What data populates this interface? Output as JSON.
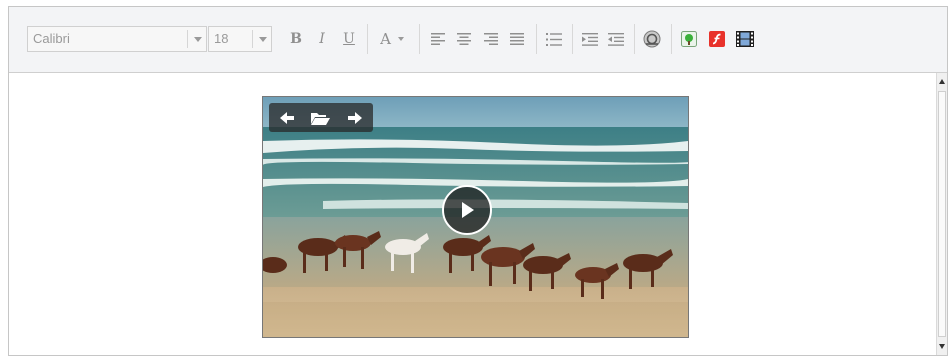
{
  "toolbar": {
    "font_family": "Calibri",
    "font_size": "18",
    "bold_label": "B",
    "italic_label": "I",
    "underline_label": "U",
    "font_color_label": "A"
  },
  "icons": [
    "align-left-icon",
    "align-center-icon",
    "align-right-icon",
    "align-justify-icon",
    "bullet-list-icon",
    "indent-icon",
    "outdent-icon",
    "link-icon",
    "image-icon",
    "flash-icon",
    "video-icon"
  ],
  "video": {
    "controls": [
      "prev-icon",
      "folder-open-icon",
      "next-icon"
    ],
    "play": "play-icon"
  },
  "colors": {
    "toolbar_bg": "#f3f4f6",
    "flash_red": "#e8322b",
    "image_green": "#3bb03b"
  }
}
